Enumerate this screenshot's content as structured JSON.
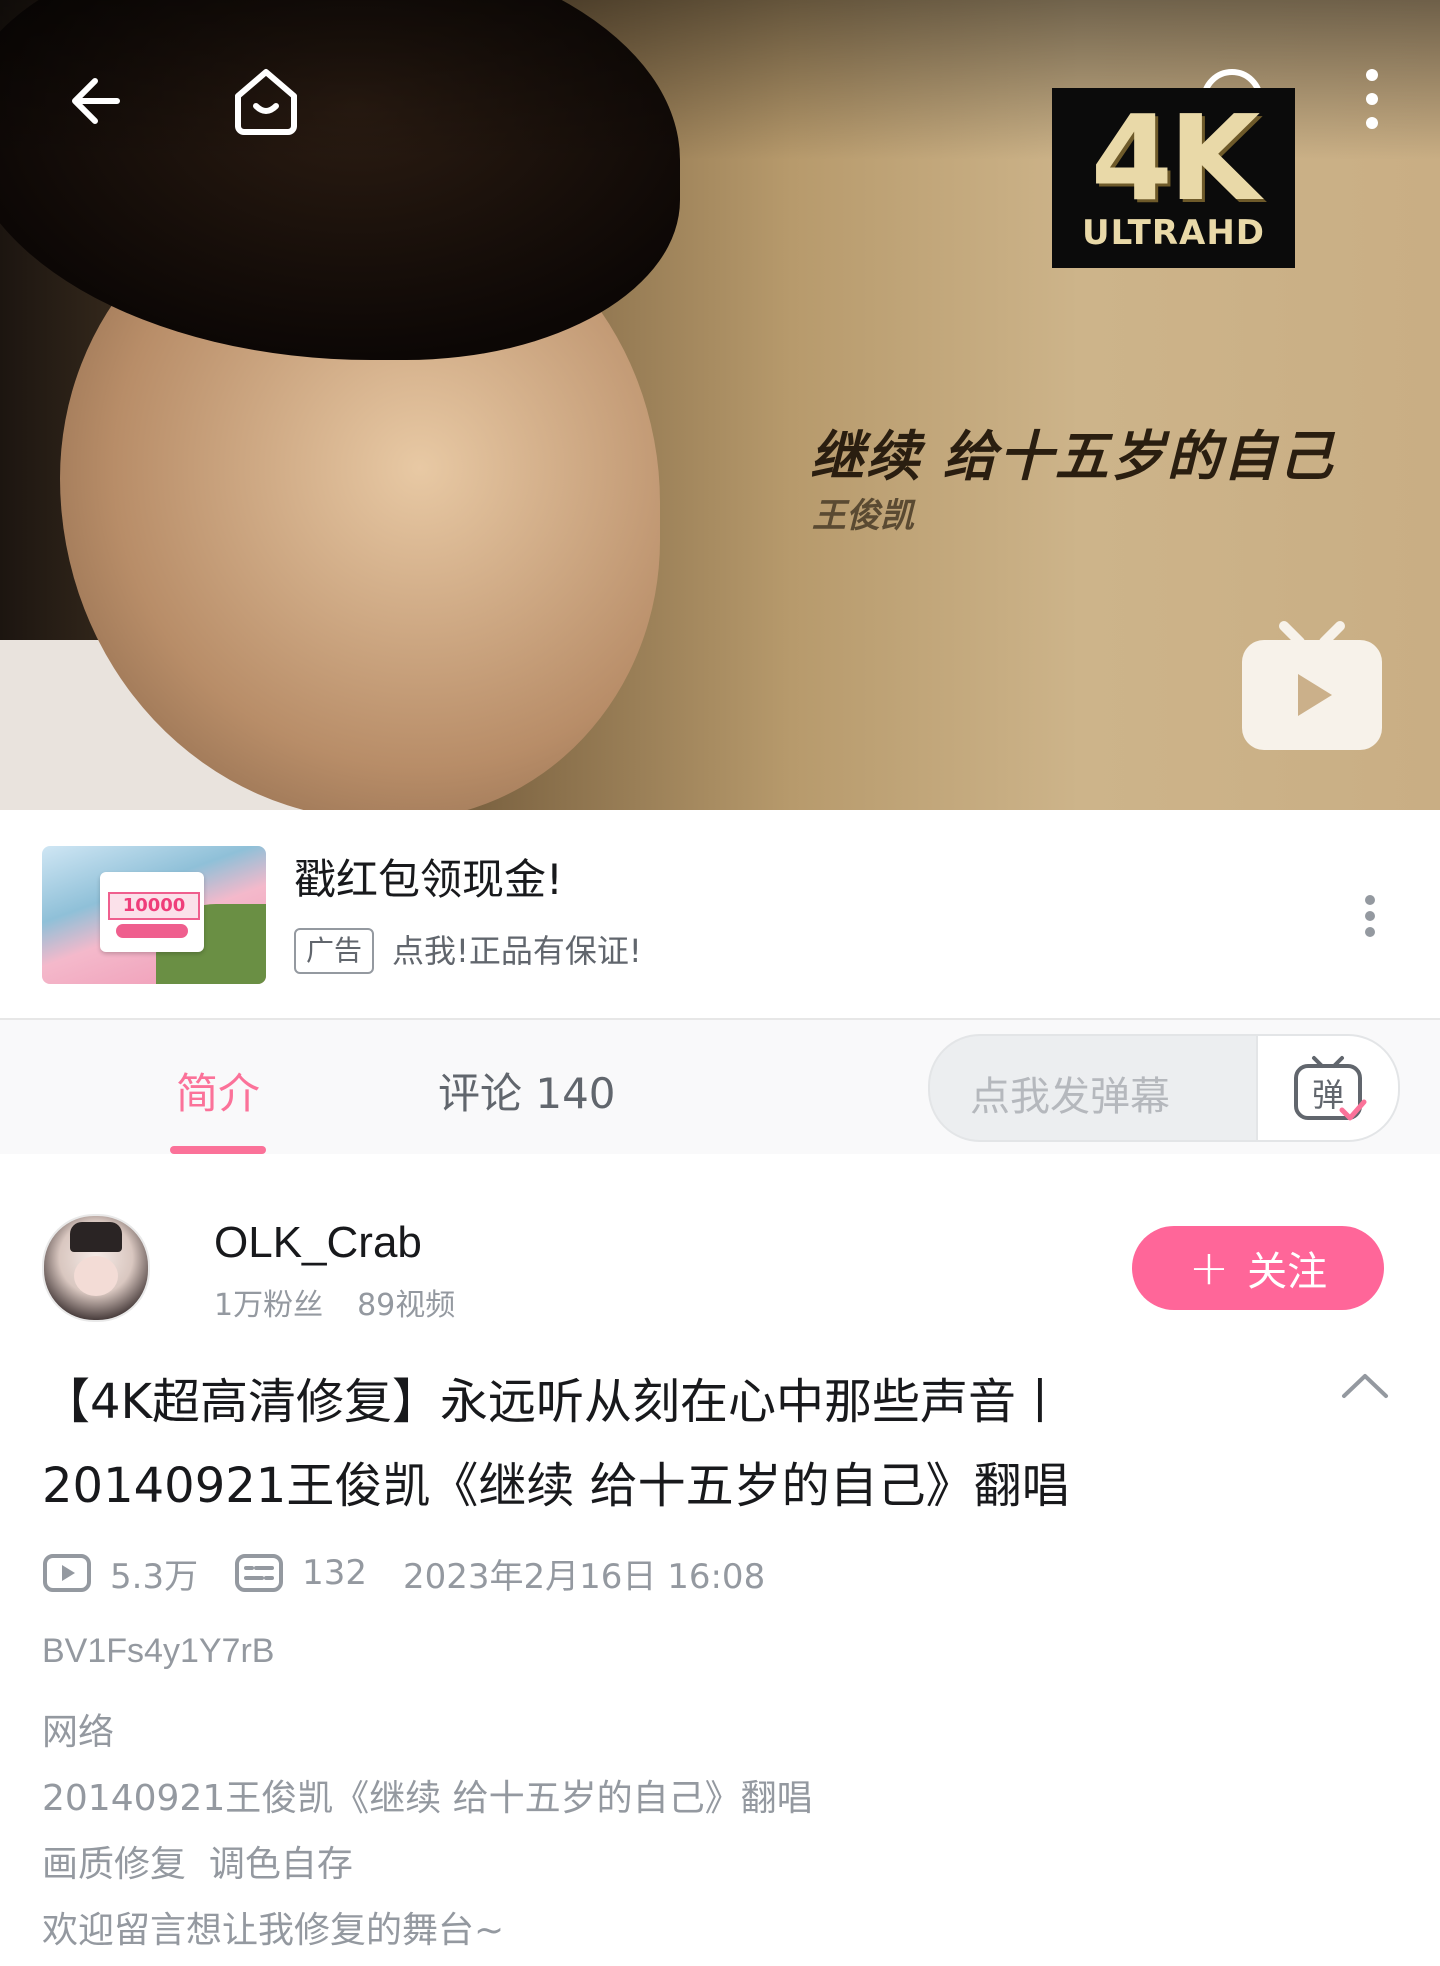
{
  "video": {
    "badge_main": "4K",
    "badge_sub": "ULTRAHD",
    "overlay_title": "继续 给十五岁的自己",
    "overlay_subtitle": "王俊凯"
  },
  "ad": {
    "thumb_amount": "10000",
    "title": "戳红包领现金!",
    "tag": "广告",
    "description": "点我!正品有保证!"
  },
  "tabs": {
    "intro": "简介",
    "comments": "评论 140",
    "danmu_placeholder": "点我发弹幕",
    "danmu_button_glyph": "弹"
  },
  "uploader": {
    "name": "OLK_Crab",
    "fans": "1万粉丝",
    "videos": "89视频",
    "follow_plus": "+",
    "follow_label": "关注"
  },
  "video_info": {
    "title_line1": "【4K超高清修复】永远听从刻在心中那些声音丨",
    "title_line2": "20140921王俊凯《继续 给十五岁的自己》翻唱",
    "views": "5.3万",
    "danmaku_count": "132",
    "publish_time": "2023年2月16日 16:08",
    "bvid": "BV1Fs4y1Y7rB",
    "description": [
      "网络",
      "20140921王俊凯《继续 给十五岁的自己》翻唱",
      "画质修复  调色自存",
      "欢迎留言想让我修复的舞台~"
    ]
  },
  "colors": {
    "accent_pink": "#fb7299",
    "follow_pink": "#ff6699",
    "secondary_text": "#9499a0"
  }
}
